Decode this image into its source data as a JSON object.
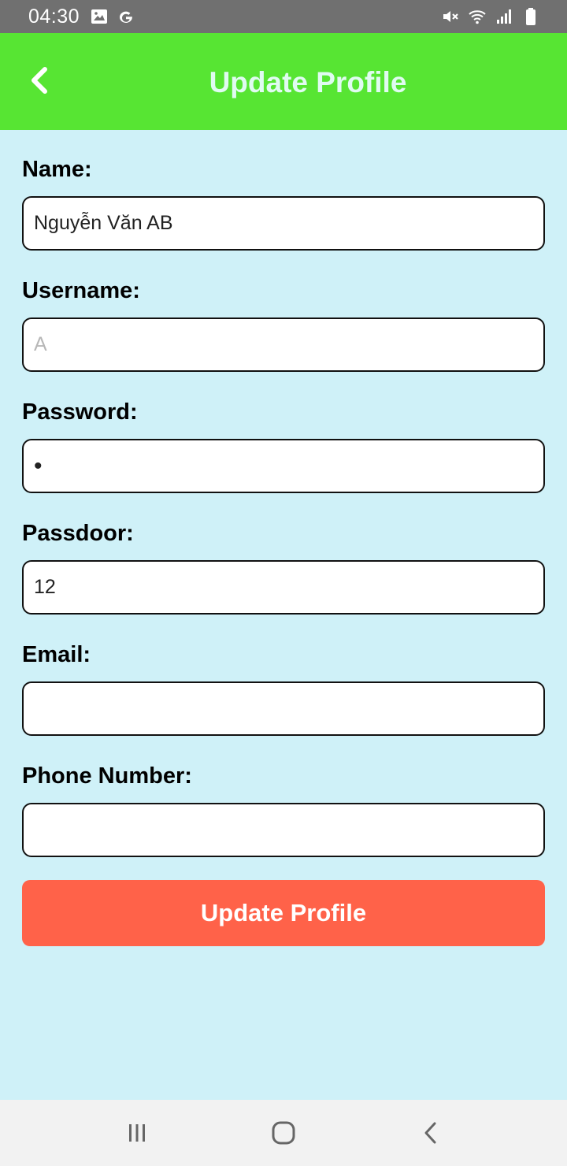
{
  "status_bar": {
    "time": "04:30",
    "left_icons": [
      "image-icon",
      "google-icon"
    ],
    "right_icons": [
      "mute-icon",
      "wifi-icon",
      "signal-icon",
      "battery-icon"
    ]
  },
  "app_bar": {
    "title": "Update Profile",
    "back_icon": "chevron-left-icon",
    "background": "#57e533",
    "title_color": "#e0fbf1"
  },
  "form": {
    "fields": [
      {
        "label": "Name:",
        "value": "Nguyễn Văn AB",
        "placeholder": ""
      },
      {
        "label": "Username:",
        "value": "",
        "placeholder": "A"
      },
      {
        "label": "Password:",
        "value": "•",
        "placeholder": ""
      },
      {
        "label": "Passdoor:",
        "value": "12",
        "placeholder": ""
      },
      {
        "label": "Email:",
        "value": "",
        "placeholder": ""
      },
      {
        "label": "Phone Number:",
        "value": "",
        "placeholder": ""
      }
    ],
    "submit_label": "Update Profile",
    "submit_color": "#ff6249",
    "background": "#cff1f8"
  },
  "nav_bar": {
    "buttons": [
      "recent-apps-icon",
      "home-icon",
      "back-icon"
    ]
  }
}
